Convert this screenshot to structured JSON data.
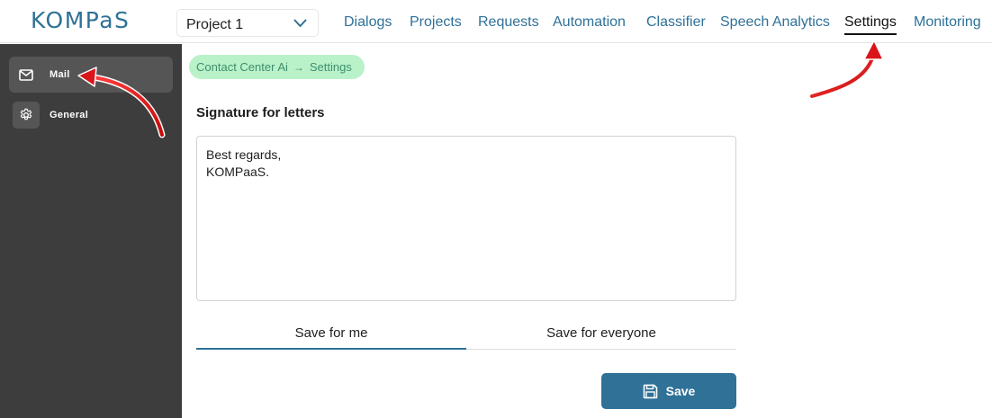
{
  "header": {
    "logo": "KOMPaS",
    "project_select": {
      "value": "Project 1",
      "icon": "chevron-down-icon"
    },
    "nav": [
      {
        "label": "Dialogs",
        "active": false
      },
      {
        "label": "Projects",
        "active": false
      },
      {
        "label": "Requests",
        "active": false
      },
      {
        "label": "Automation",
        "active": false
      },
      {
        "label": "Classifier",
        "active": false
      },
      {
        "label": "Speech Analytics",
        "active": false
      },
      {
        "label": "Settings",
        "active": true
      },
      {
        "label": "Monitoring",
        "active": false
      }
    ]
  },
  "sidebar": {
    "items": [
      {
        "label": "Mail",
        "icon": "mail-icon",
        "active": true
      },
      {
        "label": "General",
        "icon": "gear-icon",
        "active": false
      }
    ]
  },
  "main": {
    "breadcrumb": {
      "parent": "Contact Center Ai",
      "separator": "→",
      "current": "Settings"
    },
    "signature_title": "Signature for letters",
    "signature_lines": [
      "Best regards,",
      "KOMPaaS."
    ],
    "tabs": [
      {
        "label": "Save for me",
        "active": true
      },
      {
        "label": "Save for everyone",
        "active": false
      }
    ],
    "save_button": {
      "label": "Save",
      "icon": "save-icon"
    }
  },
  "colors": {
    "brand": "#2f7197",
    "sidebar_bg": "#3d3d3d",
    "breadcrumb_bg": "#b9f2c9",
    "annotation_arrow": "#e0191b"
  }
}
